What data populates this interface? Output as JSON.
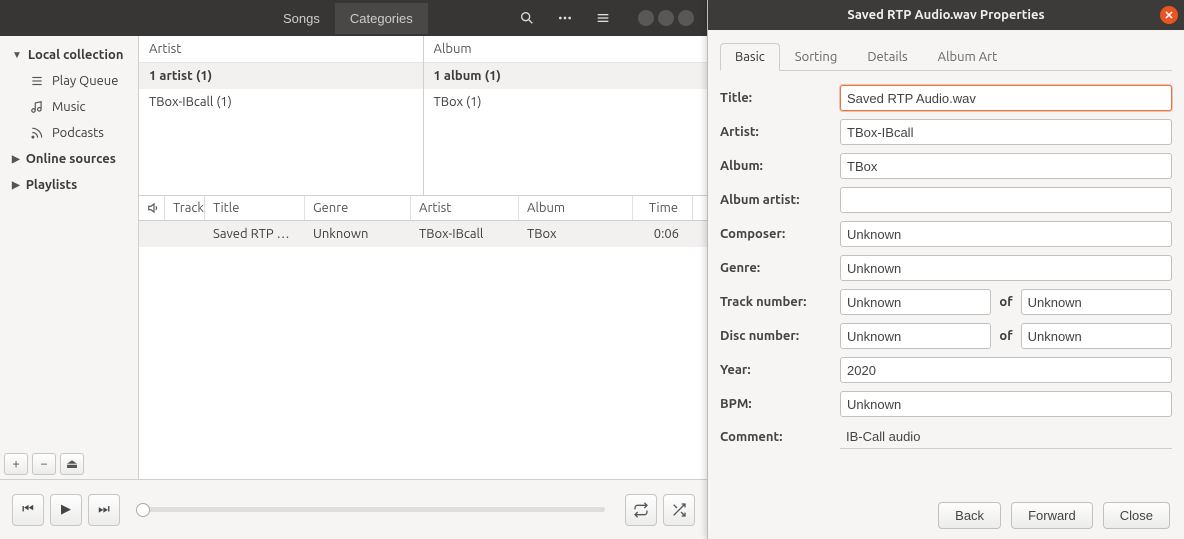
{
  "toolbar": {
    "tabs": {
      "songs": "Songs",
      "categories": "Categories"
    }
  },
  "sidebar": {
    "sections": {
      "local": "Local collection",
      "online": "Online sources",
      "playlists": "Playlists"
    },
    "items": [
      {
        "label": "Play Queue"
      },
      {
        "label": "Music"
      },
      {
        "label": "Podcasts"
      }
    ]
  },
  "browse": {
    "artist_header": "Artist",
    "album_header": "Album",
    "artist_summary": "1 artist (1)",
    "album_summary": "1 album (1)",
    "artist_row": "TBox-IBcall (1)",
    "album_row": "TBox (1)"
  },
  "tracks": {
    "headers": {
      "track": "Track",
      "title": "Title",
      "genre": "Genre",
      "artist": "Artist",
      "album": "Album",
      "time": "Time"
    },
    "row": {
      "title": "Saved RTP Au…",
      "genre": "Unknown",
      "artist": "TBox-IBcall",
      "album": "TBox",
      "time": "0:06"
    }
  },
  "dialog": {
    "title": "Saved RTP Audio.wav Properties",
    "tabs": {
      "basic": "Basic",
      "sorting": "Sorting",
      "details": "Details",
      "albumart": "Album Art"
    },
    "labels": {
      "title": "Title:",
      "artist": "Artist:",
      "album": "Album:",
      "album_artist": "Album artist:",
      "composer": "Composer:",
      "genre": "Genre:",
      "track_number": "Track number:",
      "disc_number": "Disc number:",
      "of": "of",
      "year": "Year:",
      "bpm": "BPM:",
      "comment": "Comment:"
    },
    "values": {
      "title": "Saved RTP Audio.wav",
      "artist": "TBox-IBcall",
      "album": "TBox",
      "album_artist": "",
      "composer": "Unknown",
      "genre": "Unknown",
      "track_number": "Unknown",
      "track_of": "Unknown",
      "disc_number": "Unknown",
      "disc_of": "Unknown",
      "year": "2020",
      "bpm": "Unknown",
      "comment": "IB-Call audio"
    },
    "buttons": {
      "back": "Back",
      "forward": "Forward",
      "close": "Close"
    }
  }
}
